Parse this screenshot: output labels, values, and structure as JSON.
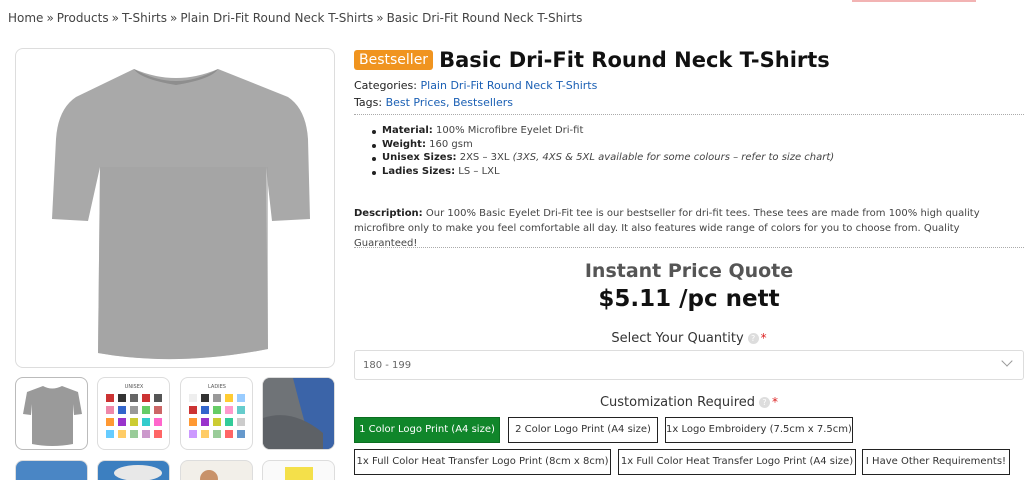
{
  "breadcrumb": {
    "items": [
      "Home",
      "Products",
      "T-Shirts",
      "Plain Dri-Fit Round Neck T-Shirts",
      "Basic Dri-Fit Round Neck T-Shirts"
    ],
    "separator": "»"
  },
  "product": {
    "badge": "Bestseller",
    "title": "Basic Dri-Fit Round Neck T-Shirts",
    "categories_label": "Categories:",
    "categories": "Plain Dri-Fit Round Neck T-Shirts",
    "tags_label": "Tags:",
    "tags": "Best Prices, Bestsellers",
    "specs": [
      {
        "label": "Material:",
        "value": "100% Microfibre Eyelet Dri-fit",
        "note": ""
      },
      {
        "label": "Weight:",
        "value": "160 gsm",
        "note": ""
      },
      {
        "label": "Unisex Sizes:",
        "value": "2XS – 3XL ",
        "note": "(3XS, 4XS & 5XL available for some colours – refer to size chart)"
      },
      {
        "label": "Ladies Sizes:",
        "value": "LS – LXL",
        "note": ""
      }
    ],
    "description_label": "Description:",
    "description": "Our 100% Basic Eyelet Dri-Fit tee is our bestseller for dri-fit tees. These tees are made from 100% high quality microfibre only to make you feel comfortable all day. It also features wide range of colors for you to choose from. Quality Guaranteed!"
  },
  "quote": {
    "title": "Instant Price Quote",
    "price": "$5.11 /pc nett",
    "quantity_label": "Select Your Quantity",
    "quantity_value": "180 - 199",
    "customization_label": "Customization Required",
    "help_glyph": "?",
    "required_mark": "*",
    "options": [
      "1 Color Logo Print (A4 size)",
      "2 Color Logo Print (A4 size)",
      "1x Logo Embroidery (7.5cm x 7.5cm)",
      "1x Full Color Heat Transfer Logo Print (8cm x 8cm)",
      "1x Full Color Heat Transfer Logo Print (A4 size)",
      "I Have Other Requirements!"
    ],
    "selected_option": "1 Color Logo Print (A4 size)"
  },
  "gallery": {
    "thumb_labels": [
      "UNISEX",
      "LADIES"
    ],
    "selected_color": "#10862a",
    "badge_color": "#f0941f"
  }
}
